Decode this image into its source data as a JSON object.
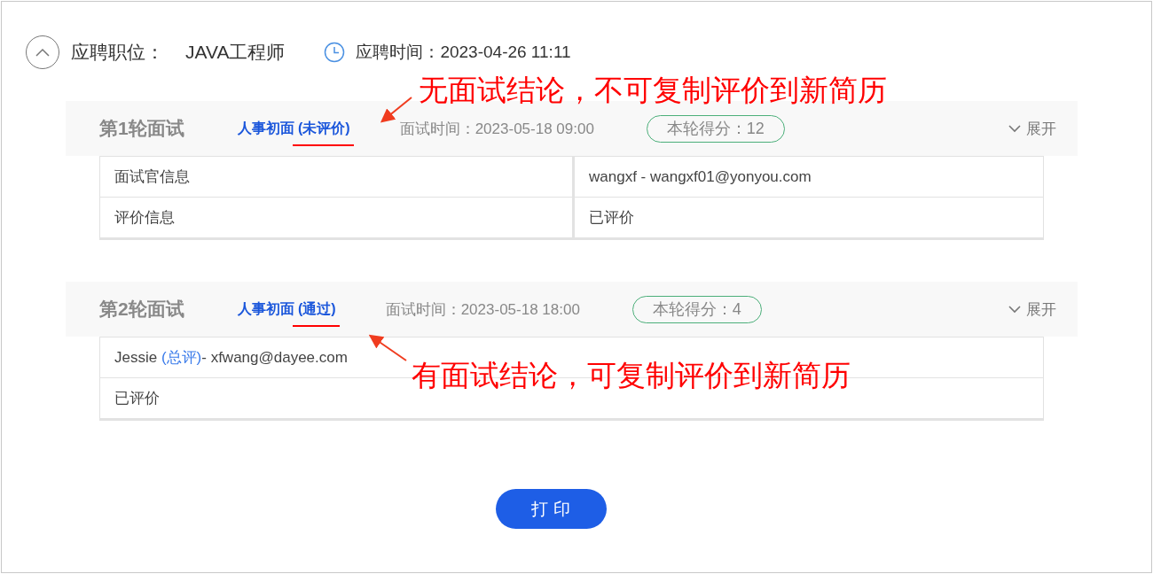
{
  "header": {
    "collapse_expanded": true,
    "position_label": "应聘职位：",
    "position": "JAVA工程师",
    "time_label": "应聘时间：2023-04-26 11:11"
  },
  "rounds": [
    {
      "title": "第1轮面试",
      "type": "人事初面",
      "status": "(未评价)",
      "time": "面试时间：2023-05-18 09:00",
      "score": "本轮得分：12",
      "toggle": "展开",
      "expanded": false,
      "kind": "pairs",
      "rows": [
        {
          "cells": [
            "面试官信息",
            "wangxf - wangxf01@yonyou.com"
          ]
        },
        {
          "cells": [
            "评价信息",
            "已评价"
          ]
        }
      ],
      "annotation": {
        "kind": "above",
        "text": "无面试结论，不可复制评价到新简历"
      }
    },
    {
      "title": "第2轮面试",
      "type": "人事初面",
      "status": "(通过)",
      "time": "面试时间：2023-05-18 18:00",
      "score": "本轮得分：4",
      "toggle": "展开",
      "expanded": false,
      "kind": "single",
      "rows": [
        {
          "name": "Jessie",
          "tag": "(总评)",
          "email": "- xfwang@dayee.com"
        },
        {
          "text": "已评价"
        }
      ],
      "annotation": {
        "kind": "below",
        "text": "有面试结论，可复制评价到新简历"
      }
    }
  ],
  "print_button": "打 印"
}
